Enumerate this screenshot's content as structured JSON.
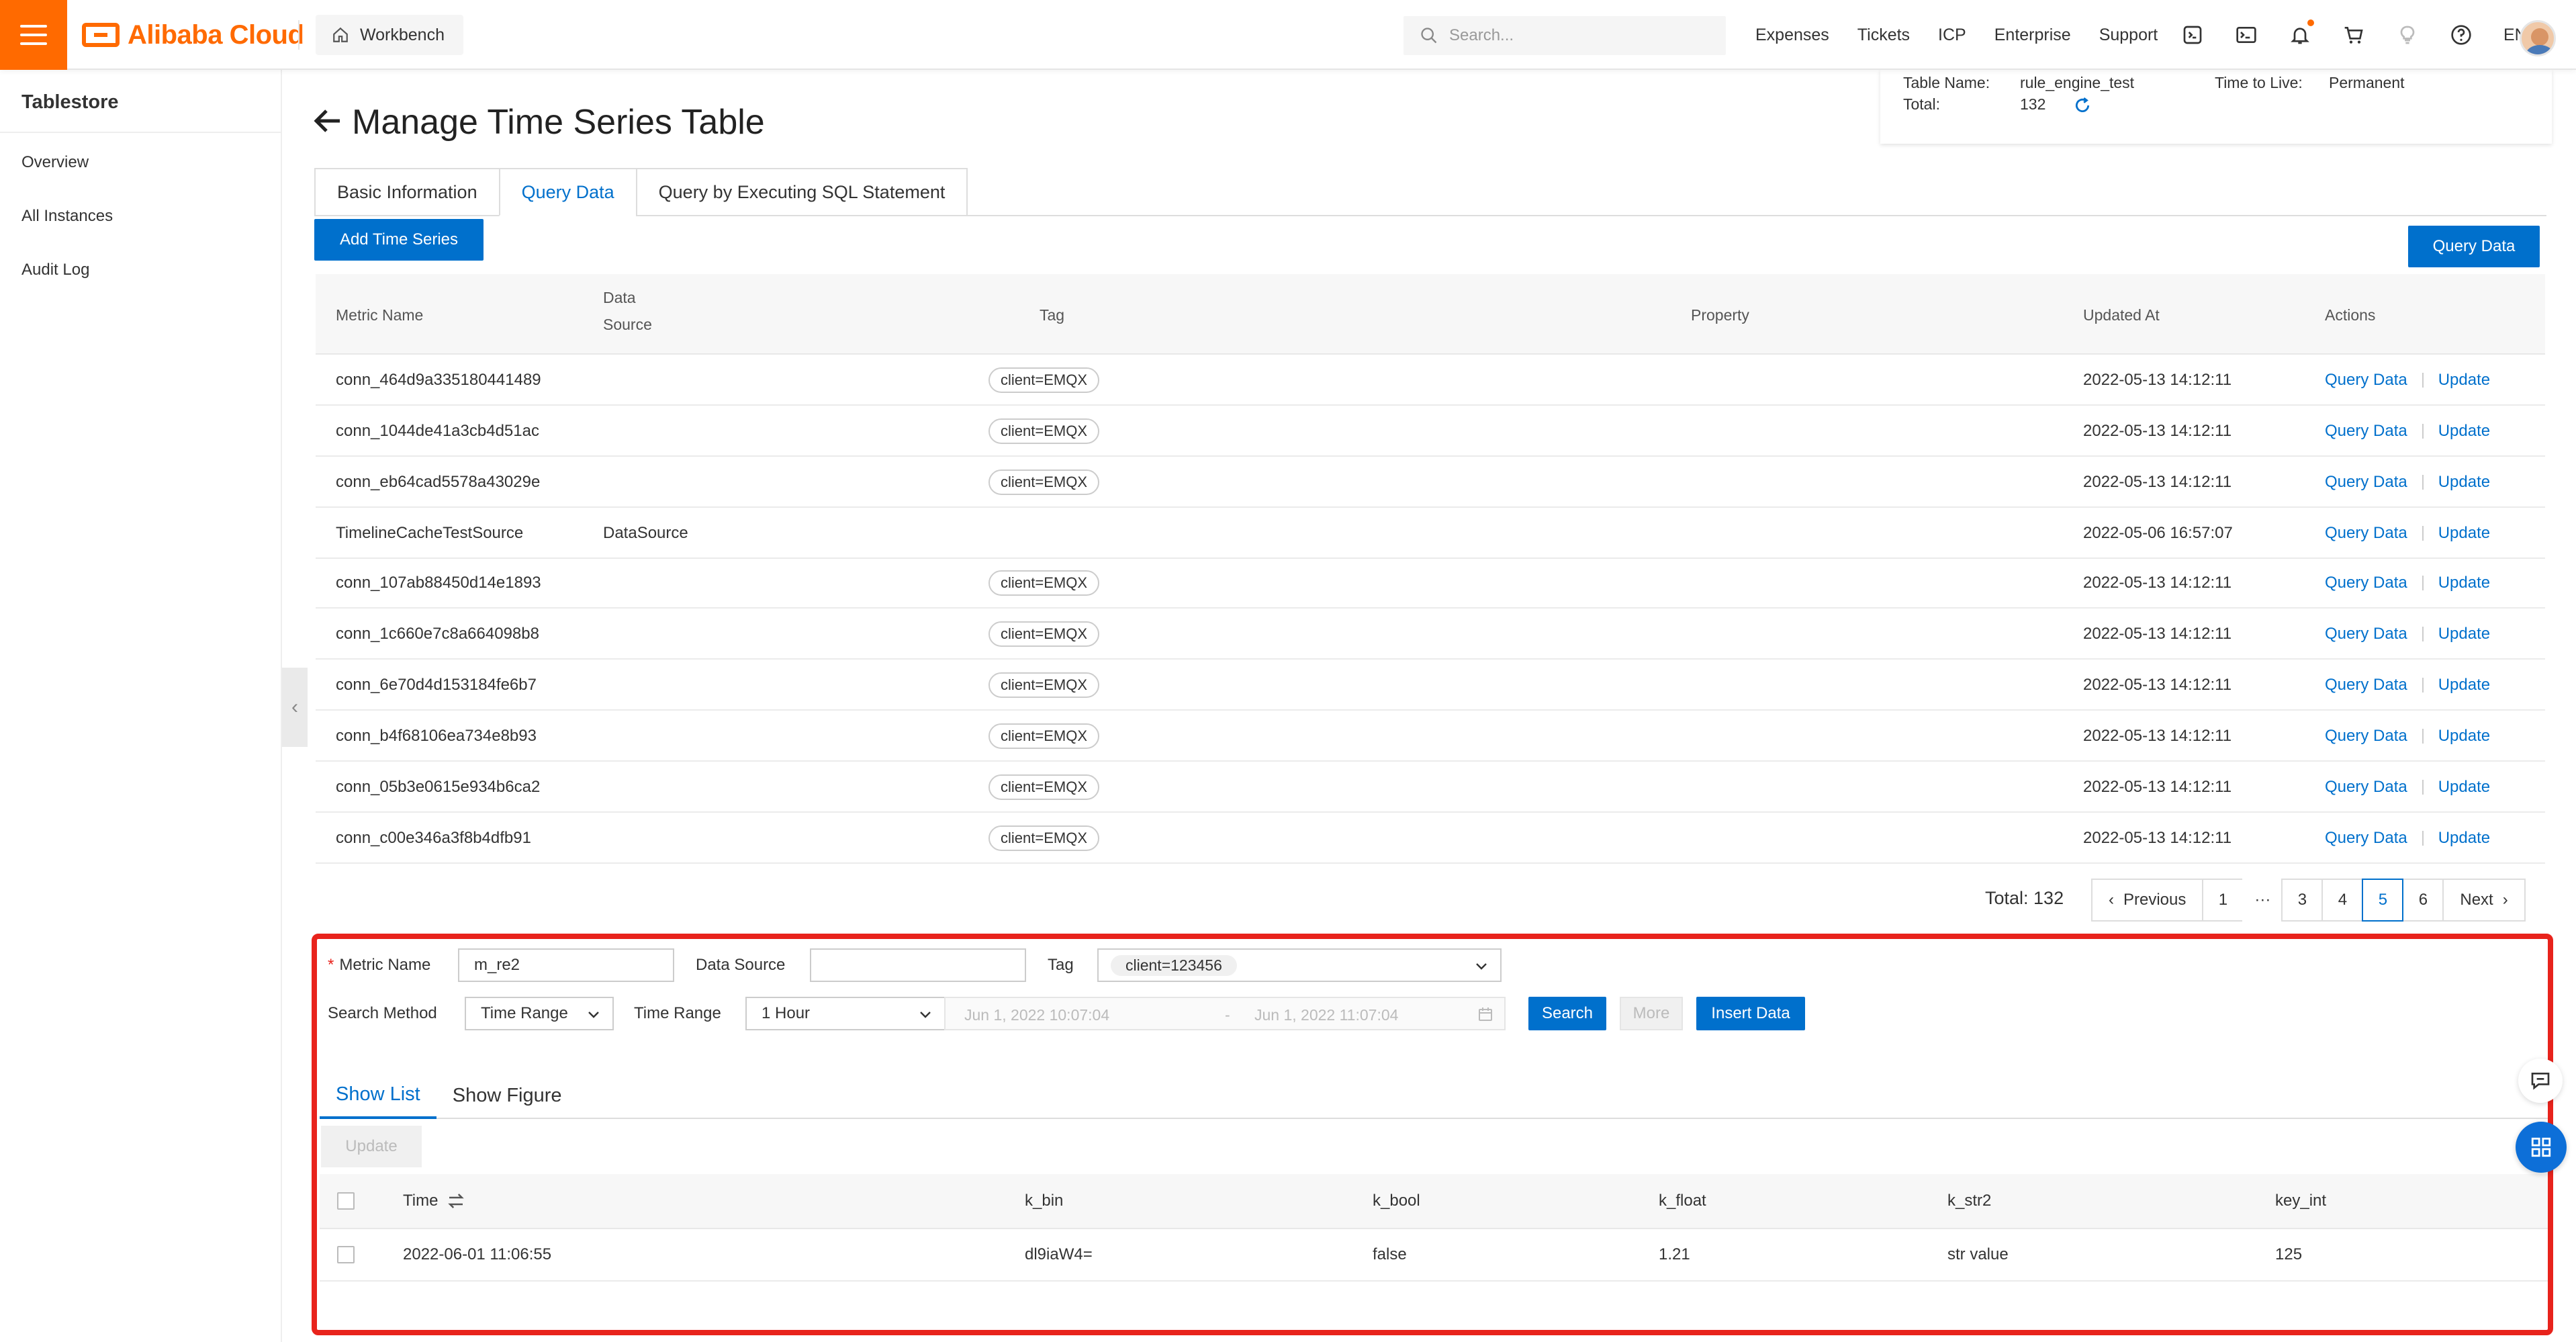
{
  "header": {
    "brand": "Alibaba Cloud",
    "workbench_label": "Workbench",
    "search_placeholder": "Search...",
    "nav": [
      "Expenses",
      "Tickets",
      "ICP",
      "Enterprise",
      "Support"
    ],
    "lang": "EN"
  },
  "sidebar": {
    "title": "Tablestore",
    "items": [
      {
        "label": "Overview"
      },
      {
        "label": "All Instances"
      },
      {
        "label": "Audit Log"
      }
    ]
  },
  "info": {
    "table_name_label": "Table Name:",
    "table_name_value": "rule_engine_test",
    "total_label": "Total:",
    "total_value": "132",
    "ttl_label": "Time to Live:",
    "ttl_value": "Permanent"
  },
  "page": {
    "title": "Manage Time Series Table"
  },
  "tabs": [
    {
      "label": "Basic Information",
      "active": false
    },
    {
      "label": "Query Data",
      "active": true
    },
    {
      "label": "Query by Executing SQL Statement",
      "active": false
    }
  ],
  "buttons": {
    "add_time_series": "Add Time Series",
    "query_data_top": "Query Data"
  },
  "table": {
    "headers": {
      "metric_name": "Metric Name",
      "data_source_1": "Data",
      "data_source_2": "Source",
      "tag": "Tag",
      "property": "Property",
      "updated_at": "Updated At",
      "actions": "Actions"
    },
    "rows": [
      {
        "metric": "conn_464d9a335180441489",
        "source": "",
        "tag": "client=EMQX",
        "updated": "2022-05-13 14:12:11",
        "action1": "Query Data",
        "action2": "Update"
      },
      {
        "metric": "conn_1044de41a3cb4d51ac",
        "source": "",
        "tag": "client=EMQX",
        "updated": "2022-05-13 14:12:11",
        "action1": "Query Data",
        "action2": "Update"
      },
      {
        "metric": "conn_eb64cad5578a43029e",
        "source": "",
        "tag": "client=EMQX",
        "updated": "2022-05-13 14:12:11",
        "action1": "Query Data",
        "action2": "Update"
      },
      {
        "metric": "TimelineCacheTestSource",
        "source": "DataSource",
        "tag": "",
        "updated": "2022-05-06 16:57:07",
        "action1": "Query Data",
        "action2": "Update"
      },
      {
        "metric": "conn_107ab88450d14e1893",
        "source": "",
        "tag": "client=EMQX",
        "updated": "2022-05-13 14:12:11",
        "action1": "Query Data",
        "action2": "Update"
      },
      {
        "metric": "conn_1c660e7c8a664098b8",
        "source": "",
        "tag": "client=EMQX",
        "updated": "2022-05-13 14:12:11",
        "action1": "Query Data",
        "action2": "Update"
      },
      {
        "metric": "conn_6e70d4d153184fe6b7",
        "source": "",
        "tag": "client=EMQX",
        "updated": "2022-05-13 14:12:11",
        "action1": "Query Data",
        "action2": "Update"
      },
      {
        "metric": "conn_b4f68106ea734e8b93",
        "source": "",
        "tag": "client=EMQX",
        "updated": "2022-05-13 14:12:11",
        "action1": "Query Data",
        "action2": "Update"
      },
      {
        "metric": "conn_05b3e0615e934b6ca2",
        "source": "",
        "tag": "client=EMQX",
        "updated": "2022-05-13 14:12:11",
        "action1": "Query Data",
        "action2": "Update"
      },
      {
        "metric": "conn_c00e346a3f8b4dfb91",
        "source": "",
        "tag": "client=EMQX",
        "updated": "2022-05-13 14:12:11",
        "action1": "Query Data",
        "action2": "Update"
      }
    ]
  },
  "pagination": {
    "total_text": "Total: 132",
    "previous": "Previous",
    "next": "Next",
    "ellipsis": "···",
    "pages": [
      "1",
      "3",
      "4",
      "5",
      "6"
    ],
    "current": "5"
  },
  "query": {
    "metric_label": "Metric Name",
    "metric_value": "m_re2",
    "source_label": "Data Source",
    "source_value": "",
    "tag_label": "Tag",
    "tag_value": "client=123456",
    "method_label": "Search Method",
    "method_value": "Time Range",
    "range_label": "Time Range",
    "range_value": "1 Hour",
    "date_start": "Jun 1, 2022 10:07:04",
    "date_sep": "-",
    "date_end": "Jun 1, 2022 11:07:04",
    "search_btn": "Search",
    "more_btn": "More",
    "insert_btn": "Insert Data"
  },
  "result": {
    "tabs": [
      {
        "label": "Show List",
        "active": true
      },
      {
        "label": "Show Figure",
        "active": false
      }
    ],
    "update_btn": "Update",
    "headers": [
      "Time",
      "k_bin",
      "k_bool",
      "k_float",
      "k_str2",
      "key_int"
    ],
    "rows": [
      [
        "2022-06-01 11:06:55",
        "dl9iaW4=",
        "false",
        "1.21",
        "str value",
        "125"
      ]
    ]
  },
  "colors": {
    "brand_orange": "#ff6a00",
    "primary_blue": "#0070cc",
    "highlight_red": "#e8231c"
  }
}
